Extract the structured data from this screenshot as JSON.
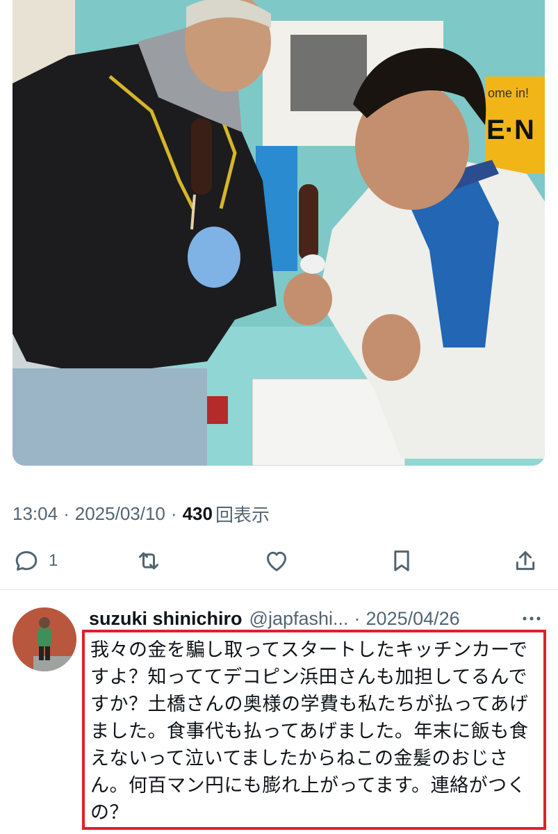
{
  "tweet": {
    "time": "13:04",
    "date": "2025/03/10",
    "views_count": "430",
    "views_label": "回表示",
    "separator": "·"
  },
  "actions": {
    "reply_icon": "reply-icon",
    "reply_count": "1",
    "retweet_icon": "retweet-icon",
    "like_icon": "heart-icon",
    "bookmark_icon": "bookmark-icon",
    "share_icon": "share-icon"
  },
  "reply": {
    "name": "suzuki shinichiro",
    "handle": "@japfashi...",
    "separator": "·",
    "date": "2025/04/26",
    "text": "我々の金を騙し取ってスタートしたキッチンカーですよ？知っててデコピン浜田さんも加担してるんですか？土橋さんの奥様の学費も私たちが払ってあげました。食事代も払ってあげました。年末に飯も食えないって泣いてましたからねこの金髪のおじさん。何百マン円にも膨れ上がってます。連絡がつくの？"
  },
  "photo": {
    "sign_text": "E·N",
    "sign_small": "ome in!"
  },
  "colors": {
    "highlight_border": "#e0202a",
    "secondary_text": "#536471",
    "primary_text": "#0f1419"
  }
}
